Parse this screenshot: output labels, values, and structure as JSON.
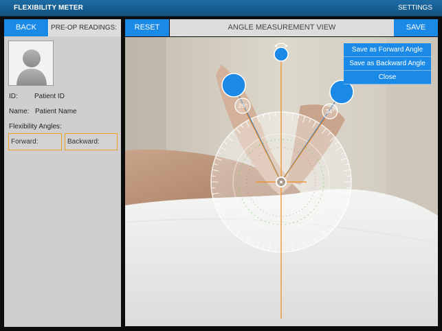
{
  "app": {
    "title": "FLEXIBILITY METER",
    "settings_label": "SETTINGS"
  },
  "left": {
    "back_label": "BACK",
    "preop_label": "PRE-OP READINGS:",
    "id_label": "ID:",
    "id_value": "Patient ID",
    "name_label": "Name:",
    "name_value": "Patient Name",
    "angles_label": "Flexibility Angles:",
    "forward_label": "Forward:",
    "backward_label": "Backward:"
  },
  "toolbar": {
    "reset_label": "RESET",
    "view_title": "ANGLE MEASUREMENT VIEW",
    "save_label": "SAVE"
  },
  "menu": {
    "save_forward": "Save as Forward Angle",
    "save_backward": "Save as Backward Angle",
    "close": "Close"
  },
  "measurement": {
    "left_angle": "26°",
    "right_angle": "34°"
  },
  "colors": {
    "accent": "#1a8ae6",
    "field_border": "#f0a020",
    "handle_line": "#f08a1c"
  }
}
